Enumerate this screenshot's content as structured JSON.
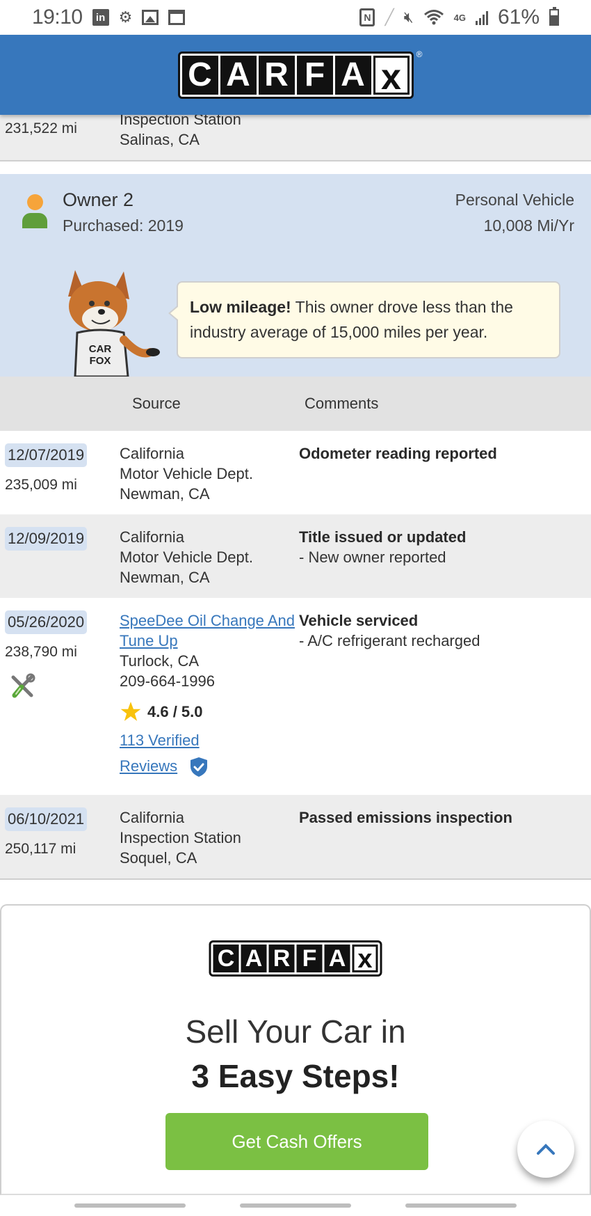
{
  "status_bar": {
    "time": "19:10",
    "battery_percent": "61%",
    "left_icons": [
      "linkedin-icon",
      "settings-icon",
      "gallery-icon",
      "calendar-icon"
    ],
    "right_icons": [
      "nfc-icon",
      "pen-icon",
      "mute-icon",
      "wifi-icon",
      "4g-lte-icon",
      "signal-icon",
      "battery-icon"
    ],
    "linkedin_glyph": "in",
    "nfc_glyph": "N",
    "lte_glyph": "4G"
  },
  "header": {
    "logo_letters": [
      "C",
      "A",
      "R",
      "F",
      "A",
      "x"
    ],
    "registered": "®",
    "brand_color": "#3777bc"
  },
  "previous_record": {
    "mileage": "231,522 mi",
    "source_lines": [
      "Inspection Station",
      "Salinas, CA"
    ]
  },
  "owner": {
    "title": "Owner 2",
    "purchased": "Purchased: 2019",
    "vehicle_type": "Personal Vehicle",
    "miles_per_year": "10,008 Mi/Yr",
    "callout_bold": "Low mileage!",
    "callout_text": " This owner drove less than the industry average of 15,000 miles per year.",
    "fox_shirt_text": "CAR FOX"
  },
  "table": {
    "headers": {
      "source": "Source",
      "comments": "Comments"
    },
    "rows": [
      {
        "date": "12/07/2019",
        "mileage": "235,009 mi",
        "source": [
          "California",
          "Motor Vehicle Dept.",
          "Newman, CA"
        ],
        "comment_title": "Odometer reading reported",
        "comment_detail": ""
      },
      {
        "date": "12/09/2019",
        "mileage": "",
        "source": [
          "California",
          "Motor Vehicle Dept.",
          "Newman, CA"
        ],
        "comment_title": "Title issued or updated",
        "comment_detail": "- New owner reported"
      },
      {
        "date": "05/26/2020",
        "mileage": "238,790 mi",
        "source_link": "SpeeDee Oil Change And Tune Up",
        "source": [
          "Turlock, CA",
          "209-664-1996"
        ],
        "rating": "4.6 / 5.0",
        "reviews_link": "113 Verified Reviews",
        "reviews_line1": "113 Verified",
        "reviews_line2": "Reviews",
        "comment_title": "Vehicle serviced",
        "comment_detail": "- A/C refrigerant recharged",
        "icon": "service-tools-icon"
      },
      {
        "date": "06/10/2021",
        "mileage": "250,117 mi",
        "source": [
          "California",
          "Inspection Station",
          "Soquel, CA"
        ],
        "comment_title": "Passed emissions inspection",
        "comment_detail": ""
      }
    ]
  },
  "promo": {
    "line1": "Sell Your Car in",
    "line2": "3 Easy Steps!",
    "button_label": "Get Cash Offers",
    "button_color": "#7bc043"
  },
  "fab": {
    "icon": "chevron-up-icon",
    "glyph": "^"
  }
}
